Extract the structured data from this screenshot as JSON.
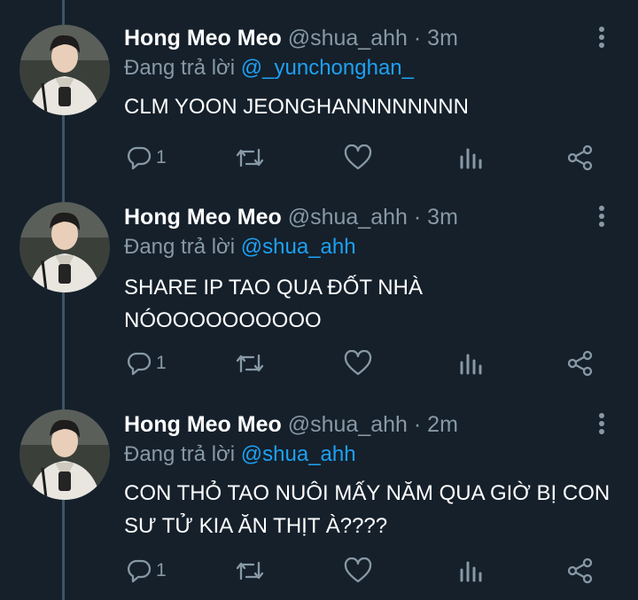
{
  "colors": {
    "background": "#15202b",
    "thread_line": "#3d5466",
    "secondary_text": "#8899a6",
    "mention": "#1da1f2"
  },
  "tweets": [
    {
      "name": "Hong Meo Meo",
      "handle": "@shua_ahh",
      "time": "· 3m",
      "reply_prefix": "Đang trả lời",
      "reply_to": "@_yunchonghan_",
      "text": "CLM YOON JEONGHANNNNNNNN",
      "reply_count": "1"
    },
    {
      "name": "Hong Meo Meo",
      "handle": "@shua_ahh",
      "time": "· 3m",
      "reply_prefix": "Đang trả lời",
      "reply_to": "@shua_ahh",
      "text": "SHARE IP TAO QUA ĐỐT NHÀ NÓOOOOOOOOOO",
      "reply_count": "1"
    },
    {
      "name": "Hong Meo Meo",
      "handle": "@shua_ahh",
      "time": "· 2m",
      "reply_prefix": "Đang trả lời",
      "reply_to": "@shua_ahh",
      "text": "CON THỎ TAO NUÔI MẤY NĂM QUA GIỜ BỊ CON SƯ TỬ KIA ĂN THỊT À????",
      "reply_count": "1"
    }
  ],
  "icons": {
    "reply": "reply-icon",
    "retweet": "retweet-icon",
    "like": "heart-icon",
    "analytics": "analytics-icon",
    "share": "share-icon",
    "more": "more-icon"
  }
}
